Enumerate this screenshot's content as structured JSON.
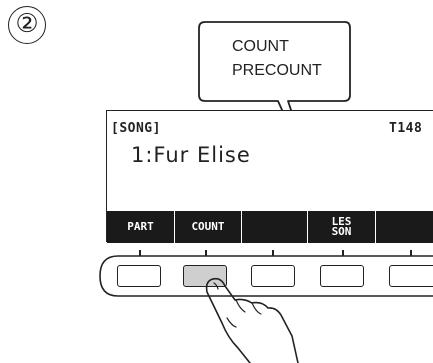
{
  "step_number": "②",
  "callout": {
    "line1": "COUNT",
    "line2": "PRECOUNT"
  },
  "lcd": {
    "mode_label": "[SONG]",
    "tempo_label": "T148",
    "song_title": "1:Fur Elise",
    "softkeys": [
      {
        "label": "PART"
      },
      {
        "label": "COUNT"
      },
      {
        "label": ""
      },
      {
        "label": "LES SON"
      },
      {
        "label": ""
      }
    ]
  },
  "panel_buttons": [
    {
      "state": "normal"
    },
    {
      "state": "pressed"
    },
    {
      "state": "normal"
    },
    {
      "state": "normal"
    },
    {
      "state": "normal"
    }
  ],
  "colors": {
    "ink": "#222222",
    "softkey_bar": "#1a1a1a",
    "pressed_button": "#cfcfcf"
  }
}
